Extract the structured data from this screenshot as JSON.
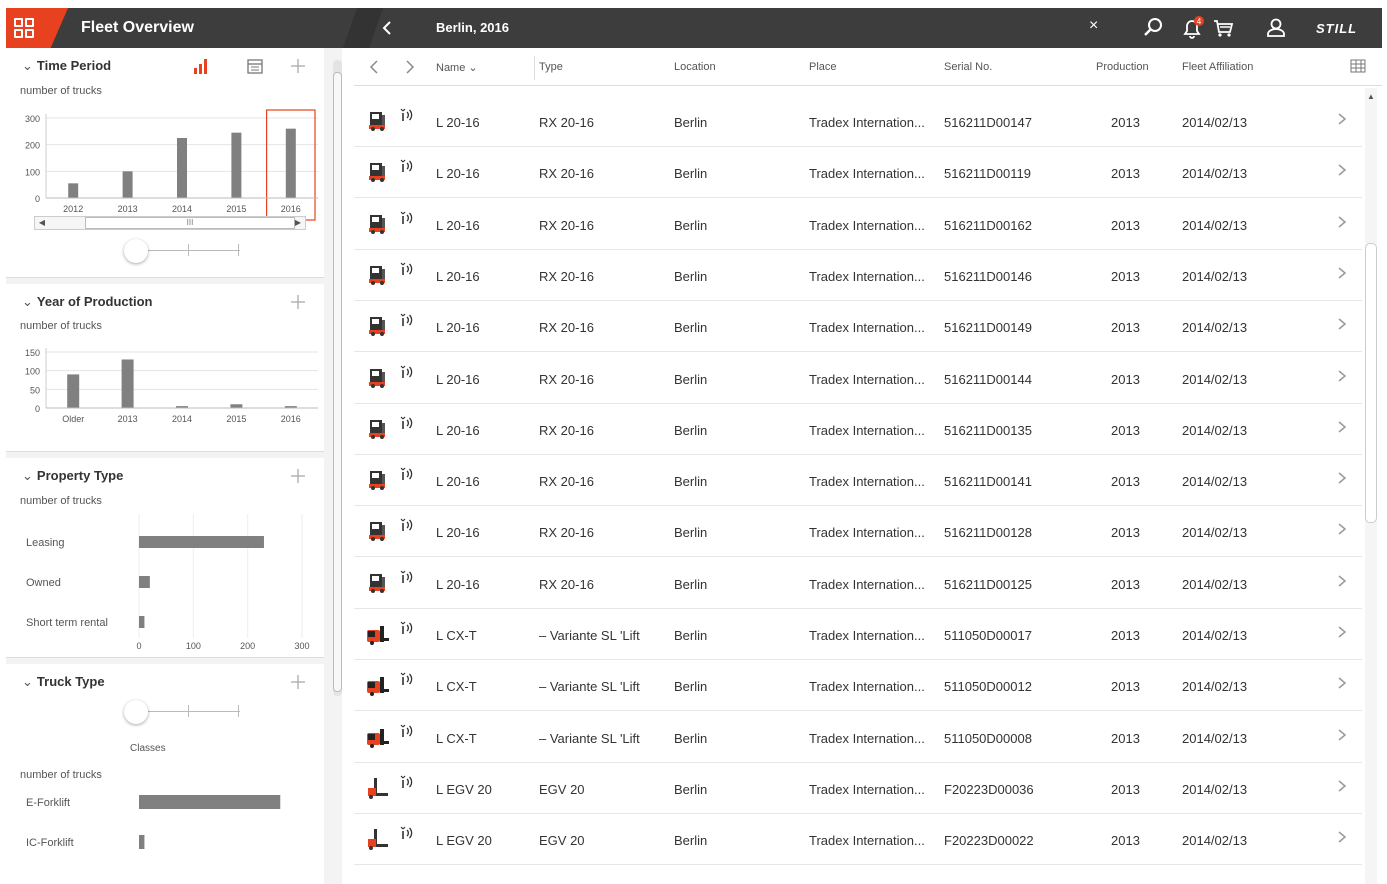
{
  "header": {
    "title": "Fleet Overview",
    "breadcrumb": "Berlin, 2016",
    "close": "×",
    "notification_count": "4",
    "brand": "STILL"
  },
  "sidebar": {
    "time_period": {
      "title": "Time Period",
      "subtitle": "number of trucks",
      "scroll_label": "III",
      "chart_data": {
        "type": "bar",
        "categories": [
          "2012",
          "2013",
          "2014",
          "2015",
          "2016"
        ],
        "values": [
          55,
          100,
          225,
          245,
          260
        ],
        "ylim": [
          0,
          300
        ],
        "yticks": [
          "300",
          "200",
          "100",
          "0"
        ],
        "selected": "2016"
      }
    },
    "year_of_production": {
      "title": "Year of Production",
      "subtitle": "number of trucks",
      "chart_data": {
        "type": "bar",
        "categories": [
          "Older",
          "2013",
          "2014",
          "2015",
          "2016"
        ],
        "values": [
          90,
          130,
          5,
          10,
          5
        ],
        "ylim": [
          0,
          150
        ],
        "yticks": [
          "150",
          "100",
          "50",
          "0"
        ]
      }
    },
    "property_type": {
      "title": "Property Type",
      "subtitle": "number of trucks",
      "chart_data": {
        "type": "bar",
        "orientation": "horizontal",
        "categories": [
          "Leasing",
          "Owned",
          "Short term rental"
        ],
        "values": [
          230,
          20,
          10
        ],
        "xlim": [
          0,
          300
        ],
        "xticks": [
          "0",
          "100",
          "200",
          "300"
        ]
      }
    },
    "truck_type": {
      "title": "Truck Type",
      "slider_label": "Classes",
      "subtitle": "number of trucks",
      "chart_data": {
        "type": "bar",
        "orientation": "horizontal",
        "categories": [
          "E-Forklift",
          "IC-Forklift"
        ],
        "values": [
          260,
          10
        ],
        "xlim": [
          0,
          300
        ]
      }
    }
  },
  "table": {
    "columns": [
      "Name",
      "Type",
      "Location",
      "Place",
      "Serial No.",
      "Production",
      "Fleet Affiliation"
    ],
    "rows": [
      {
        "name": "L 20-16",
        "type": "RX 20-16",
        "location": "Berlin",
        "place": "Tradex Internation...",
        "serial": "516211D00147",
        "production": "2013",
        "affiliation": "2014/02/13",
        "icon": "rx-truck"
      },
      {
        "name": "L 20-16",
        "type": "RX 20-16",
        "location": "Berlin",
        "place": "Tradex Internation...",
        "serial": "516211D00119",
        "production": "2013",
        "affiliation": "2014/02/13",
        "icon": "rx-truck"
      },
      {
        "name": "L 20-16",
        "type": "RX 20-16",
        "location": "Berlin",
        "place": "Tradex Internation...",
        "serial": "516211D00162",
        "production": "2013",
        "affiliation": "2014/02/13",
        "icon": "rx-truck"
      },
      {
        "name": "L 20-16",
        "type": "RX 20-16",
        "location": "Berlin",
        "place": "Tradex Internation...",
        "serial": "516211D00146",
        "production": "2013",
        "affiliation": "2014/02/13",
        "icon": "rx-truck"
      },
      {
        "name": "L 20-16",
        "type": "RX 20-16",
        "location": "Berlin",
        "place": "Tradex Internation...",
        "serial": "516211D00149",
        "production": "2013",
        "affiliation": "2014/02/13",
        "icon": "rx-truck"
      },
      {
        "name": "L 20-16",
        "type": "RX 20-16",
        "location": "Berlin",
        "place": "Tradex Internation...",
        "serial": "516211D00144",
        "production": "2013",
        "affiliation": "2014/02/13",
        "icon": "rx-truck"
      },
      {
        "name": "L 20-16",
        "type": "RX 20-16",
        "location": "Berlin",
        "place": "Tradex Internation...",
        "serial": "516211D00135",
        "production": "2013",
        "affiliation": "2014/02/13",
        "icon": "rx-truck"
      },
      {
        "name": "L 20-16",
        "type": "RX 20-16",
        "location": "Berlin",
        "place": "Tradex Internation...",
        "serial": "516211D00141",
        "production": "2013",
        "affiliation": "2014/02/13",
        "icon": "rx-truck"
      },
      {
        "name": "L 20-16",
        "type": "RX 20-16",
        "location": "Berlin",
        "place": "Tradex Internation...",
        "serial": "516211D00128",
        "production": "2013",
        "affiliation": "2014/02/13",
        "icon": "rx-truck"
      },
      {
        "name": "L 20-16",
        "type": "RX 20-16",
        "location": "Berlin",
        "place": "Tradex Internation...",
        "serial": "516211D00125",
        "production": "2013",
        "affiliation": "2014/02/13",
        "icon": "rx-truck"
      },
      {
        "name": "L CX-T",
        "type": "– Variante SL 'Lift",
        "location": "Berlin",
        "place": "Tradex Internation...",
        "serial": "511050D00017",
        "production": "2013",
        "affiliation": "2014/02/13",
        "icon": "cx-truck"
      },
      {
        "name": "L CX-T",
        "type": "– Variante SL 'Lift",
        "location": "Berlin",
        "place": "Tradex Internation...",
        "serial": "511050D00012",
        "production": "2013",
        "affiliation": "2014/02/13",
        "icon": "cx-truck"
      },
      {
        "name": "L CX-T",
        "type": "– Variante SL 'Lift",
        "location": "Berlin",
        "place": "Tradex Internation...",
        "serial": "511050D00008",
        "production": "2013",
        "affiliation": "2014/02/13",
        "icon": "cx-truck"
      },
      {
        "name": "L EGV 20",
        "type": "EGV 20",
        "location": "Berlin",
        "place": "Tradex Internation...",
        "serial": "F20223D00036",
        "production": "2013",
        "affiliation": "2014/02/13",
        "icon": "egv-truck"
      },
      {
        "name": "L EGV 20",
        "type": "EGV 20",
        "location": "Berlin",
        "place": "Tradex Internation...",
        "serial": "F20223D00022",
        "production": "2013",
        "affiliation": "2014/02/13",
        "icon": "egv-truck"
      }
    ]
  },
  "colors": {
    "accent": "#e8411f",
    "topbar": "#3d3d3d",
    "bar": "#808080"
  }
}
